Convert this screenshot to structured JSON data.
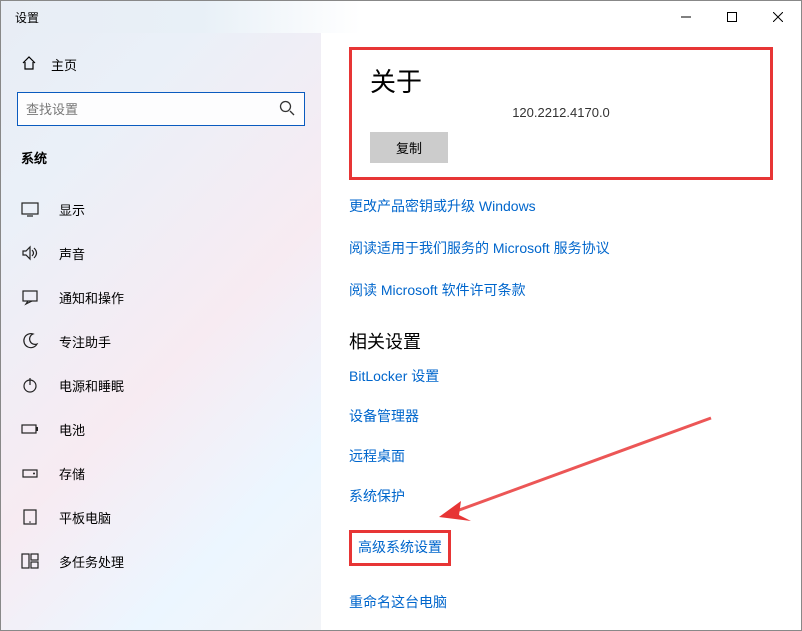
{
  "window": {
    "title": "设置"
  },
  "sidebar": {
    "home": "主页",
    "search_placeholder": "查找设置",
    "section": "系统",
    "items": [
      {
        "label": "显示"
      },
      {
        "label": "声音"
      },
      {
        "label": "通知和操作"
      },
      {
        "label": "专注助手"
      },
      {
        "label": "电源和睡眠"
      },
      {
        "label": "电池"
      },
      {
        "label": "存储"
      },
      {
        "label": "平板电脑"
      },
      {
        "label": "多任务处理"
      }
    ]
  },
  "main": {
    "about_heading": "关于",
    "version": "120.2212.4170.0",
    "copy_label": "复制",
    "links": [
      "更改产品密钥或升级 Windows",
      "阅读适用于我们服务的 Microsoft 服务协议",
      "阅读 Microsoft 软件许可条款"
    ],
    "related_heading": "相关设置",
    "related": [
      "BitLocker 设置",
      "设备管理器",
      "远程桌面",
      "系统保护",
      "高级系统设置",
      "重命名这台电脑"
    ]
  }
}
